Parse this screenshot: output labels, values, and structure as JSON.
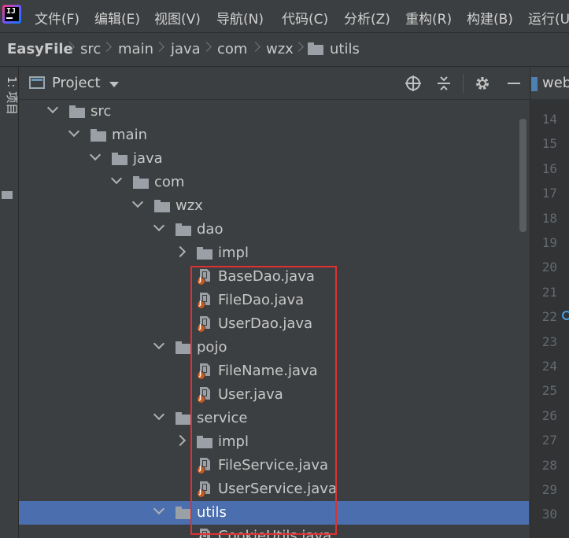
{
  "menubar": {
    "items": [
      "文件(F)",
      "编辑(E)",
      "视图(V)",
      "导航(N)",
      "代码(C)",
      "分析(Z)",
      "重构(R)",
      "构建(B)",
      "运行(U)"
    ]
  },
  "breadcrumb": {
    "project": "EasyFile",
    "path": [
      "src",
      "main",
      "java",
      "com",
      "wzx",
      "utils"
    ]
  },
  "toolwindow_strip": {
    "label": "1: 项目"
  },
  "project_panel": {
    "title": "Project",
    "toolbar": {
      "locate_icon": "crosshair-icon",
      "collapse_icon": "collapse-all-icon",
      "settings_icon": "gear-icon",
      "hide_icon": "minimize-icon"
    }
  },
  "tree": [
    {
      "label": "src",
      "kind": "folder",
      "expanded": true,
      "depth": 0
    },
    {
      "label": "main",
      "kind": "folder",
      "expanded": true,
      "depth": 1
    },
    {
      "label": "java",
      "kind": "folder",
      "expanded": true,
      "depth": 2
    },
    {
      "label": "com",
      "kind": "folder",
      "expanded": true,
      "depth": 3
    },
    {
      "label": "wzx",
      "kind": "folder",
      "expanded": true,
      "depth": 4
    },
    {
      "label": "dao",
      "kind": "folder",
      "expanded": true,
      "depth": 5
    },
    {
      "label": "impl",
      "kind": "folder",
      "expanded": false,
      "depth": 6
    },
    {
      "label": "BaseDao.java",
      "kind": "java",
      "depth": 6
    },
    {
      "label": "FileDao.java",
      "kind": "java",
      "depth": 6
    },
    {
      "label": "UserDao.java",
      "kind": "java",
      "depth": 6
    },
    {
      "label": "pojo",
      "kind": "folder",
      "expanded": true,
      "depth": 5
    },
    {
      "label": "FileName.java",
      "kind": "java",
      "depth": 6
    },
    {
      "label": "User.java",
      "kind": "java",
      "depth": 6
    },
    {
      "label": "service",
      "kind": "folder",
      "expanded": true,
      "depth": 5
    },
    {
      "label": "impl",
      "kind": "folder",
      "expanded": false,
      "depth": 6
    },
    {
      "label": "FileService.java",
      "kind": "java",
      "depth": 6
    },
    {
      "label": "UserService.java",
      "kind": "java",
      "depth": 6
    },
    {
      "label": "utils",
      "kind": "folder",
      "expanded": true,
      "depth": 5,
      "selected": true
    },
    {
      "label": "CookieUtils.java",
      "kind": "java",
      "depth": 6
    }
  ],
  "editor": {
    "tab_label": "web",
    "line_numbers": [
      "14",
      "15",
      "16",
      "17",
      "18",
      "19",
      "20",
      "21",
      "22",
      "23",
      "24",
      "25",
      "26",
      "27",
      "28",
      "29",
      "30"
    ]
  },
  "colors": {
    "background": "#3c3f41",
    "selection": "#4b6eaf",
    "highlight_box": "#e03030"
  }
}
